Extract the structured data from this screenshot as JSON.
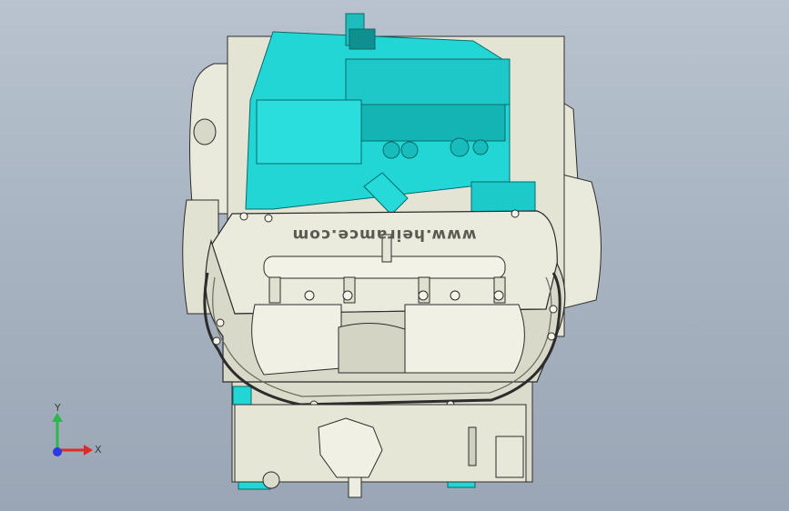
{
  "viewport": {
    "title": "",
    "background_top": "#b9c3cf",
    "background_bottom": "#9aa6b5"
  },
  "model": {
    "logo_text": "www.heiramce.com",
    "colors": {
      "cyan_part": "#22d6d6",
      "cyan_dark": "#0fa6a6",
      "body_part": "#eaeadc",
      "body_shadow": "#c9c9b8",
      "edge": "#2c2c2c"
    }
  },
  "triad": {
    "x_label": "X",
    "y_label": "Y",
    "x_color": "#e02a2a",
    "y_color": "#2ab84a",
    "z_color": "#2a3ae0"
  }
}
